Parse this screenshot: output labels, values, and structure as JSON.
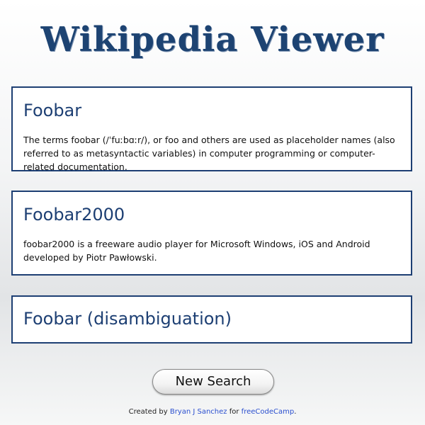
{
  "app": {
    "title": "Wikipedia Viewer",
    "title_color": "#1d4372"
  },
  "results": [
    {
      "title": "Foobar",
      "extract": "The terms foobar (/ˈfuːbɑːr/), or foo and others are used as placeholder names (also referred to as metasyntactic variables) in computer programming or computer-related documentation."
    },
    {
      "title": "Foobar2000",
      "extract": "foobar2000 is a freeware audio player for Microsoft Windows, iOS and Android developed by Piotr Pawłowski."
    },
    {
      "title": "Foobar (disambiguation)",
      "extract": ""
    }
  ],
  "actions": {
    "new_search_label": "New Search"
  },
  "footer": {
    "created_by": "Created by",
    "author": "Bryan J Sanchez",
    "for": "for",
    "org": "freeCodeCamp",
    "end": ".",
    "link_color": "#2a4fcf"
  },
  "colors": {
    "card_border": "#1d3f73",
    "card_title": "#1d3f73"
  }
}
